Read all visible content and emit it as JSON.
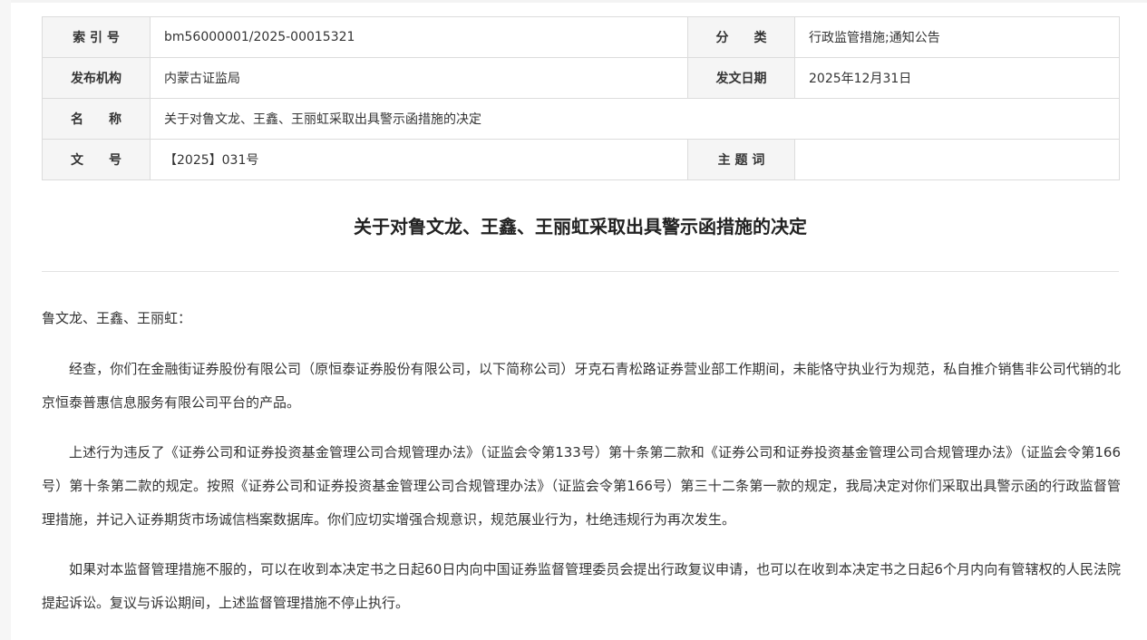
{
  "meta": {
    "index_label": "索 引 号",
    "index_value": "bm56000001/2025-00015321",
    "category_label": "分　　类",
    "category_value": "行政监管措施;通知公告",
    "publisher_label": "发布机构",
    "publisher_value": "内蒙古证监局",
    "date_label": "发文日期",
    "date_value": "2025年12月31日",
    "name_label": "名　　称",
    "name_value": "关于对鲁文龙、王鑫、王丽虹采取出具警示函措施的决定",
    "docno_label": "文　　号",
    "docno_value": "【2025】031号",
    "keywords_label": "主 题 词",
    "keywords_value": ""
  },
  "article": {
    "title": "关于对鲁文龙、王鑫、王丽虹采取出具警示函措施的决定",
    "salutation": "鲁文龙、王鑫、王丽虹：",
    "paragraphs": [
      "经查，你们在金融街证券股份有限公司（原恒泰证券股份有限公司，以下简称公司）牙克石青松路证券营业部工作期间，未能恪守执业行为规范，私自推介销售非公司代销的北京恒泰普惠信息服务有限公司平台的产品。",
      "上述行为违反了《证券公司和证券投资基金管理公司合规管理办法》（证监会令第133号）第十条第二款和《证券公司和证券投资基金管理公司合规管理办法》（证监会令第166号）第十条第二款的规定。按照《证券公司和证券投资基金管理公司合规管理办法》（证监会令第166号）第三十二条第一款的规定，我局决定对你们采取出具警示函的行政监督管理措施，并记入证券期货市场诚信档案数据库。你们应切实增强合规意识，规范展业行为，杜绝违规行为再次发生。",
      "如果对本监督管理措施不服的，可以在收到本决定书之日起60日内向中国证券监督管理委员会提出行政复议申请，也可以在收到本决定书之日起6个月内向有管辖权的人民法院提起诉讼。复议与诉讼期间，上述监督管理措施不停止执行。"
    ]
  }
}
